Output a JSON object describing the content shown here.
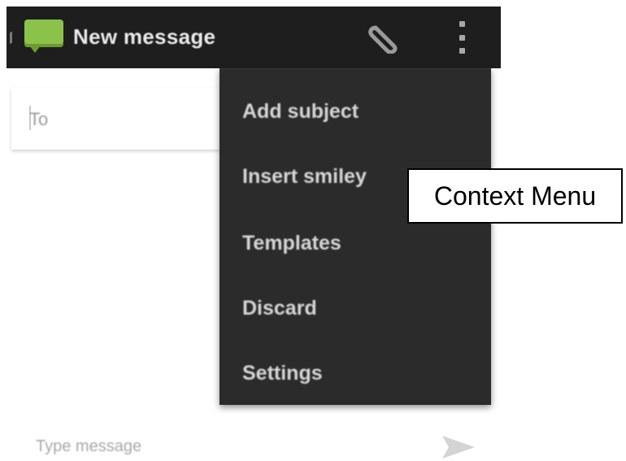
{
  "action_bar": {
    "title": "New message",
    "app_icon": "message-bubble-icon",
    "attach_icon": "paperclip-icon",
    "overflow_icon": "more-vertical-icon"
  },
  "to_field": {
    "label": "To"
  },
  "compose": {
    "placeholder": "Type message",
    "send_icon": "send-icon"
  },
  "context_menu": {
    "items": [
      {
        "label": "Add subject"
      },
      {
        "label": "Insert smiley"
      },
      {
        "label": "Templates"
      },
      {
        "label": "Discard"
      },
      {
        "label": "Settings"
      }
    ]
  },
  "annotation": {
    "label": "Context Menu"
  },
  "colors": {
    "action_bar": "#1e1e1e",
    "menu_background": "#2b2b2b",
    "app_icon_green": "#8bc34a"
  }
}
